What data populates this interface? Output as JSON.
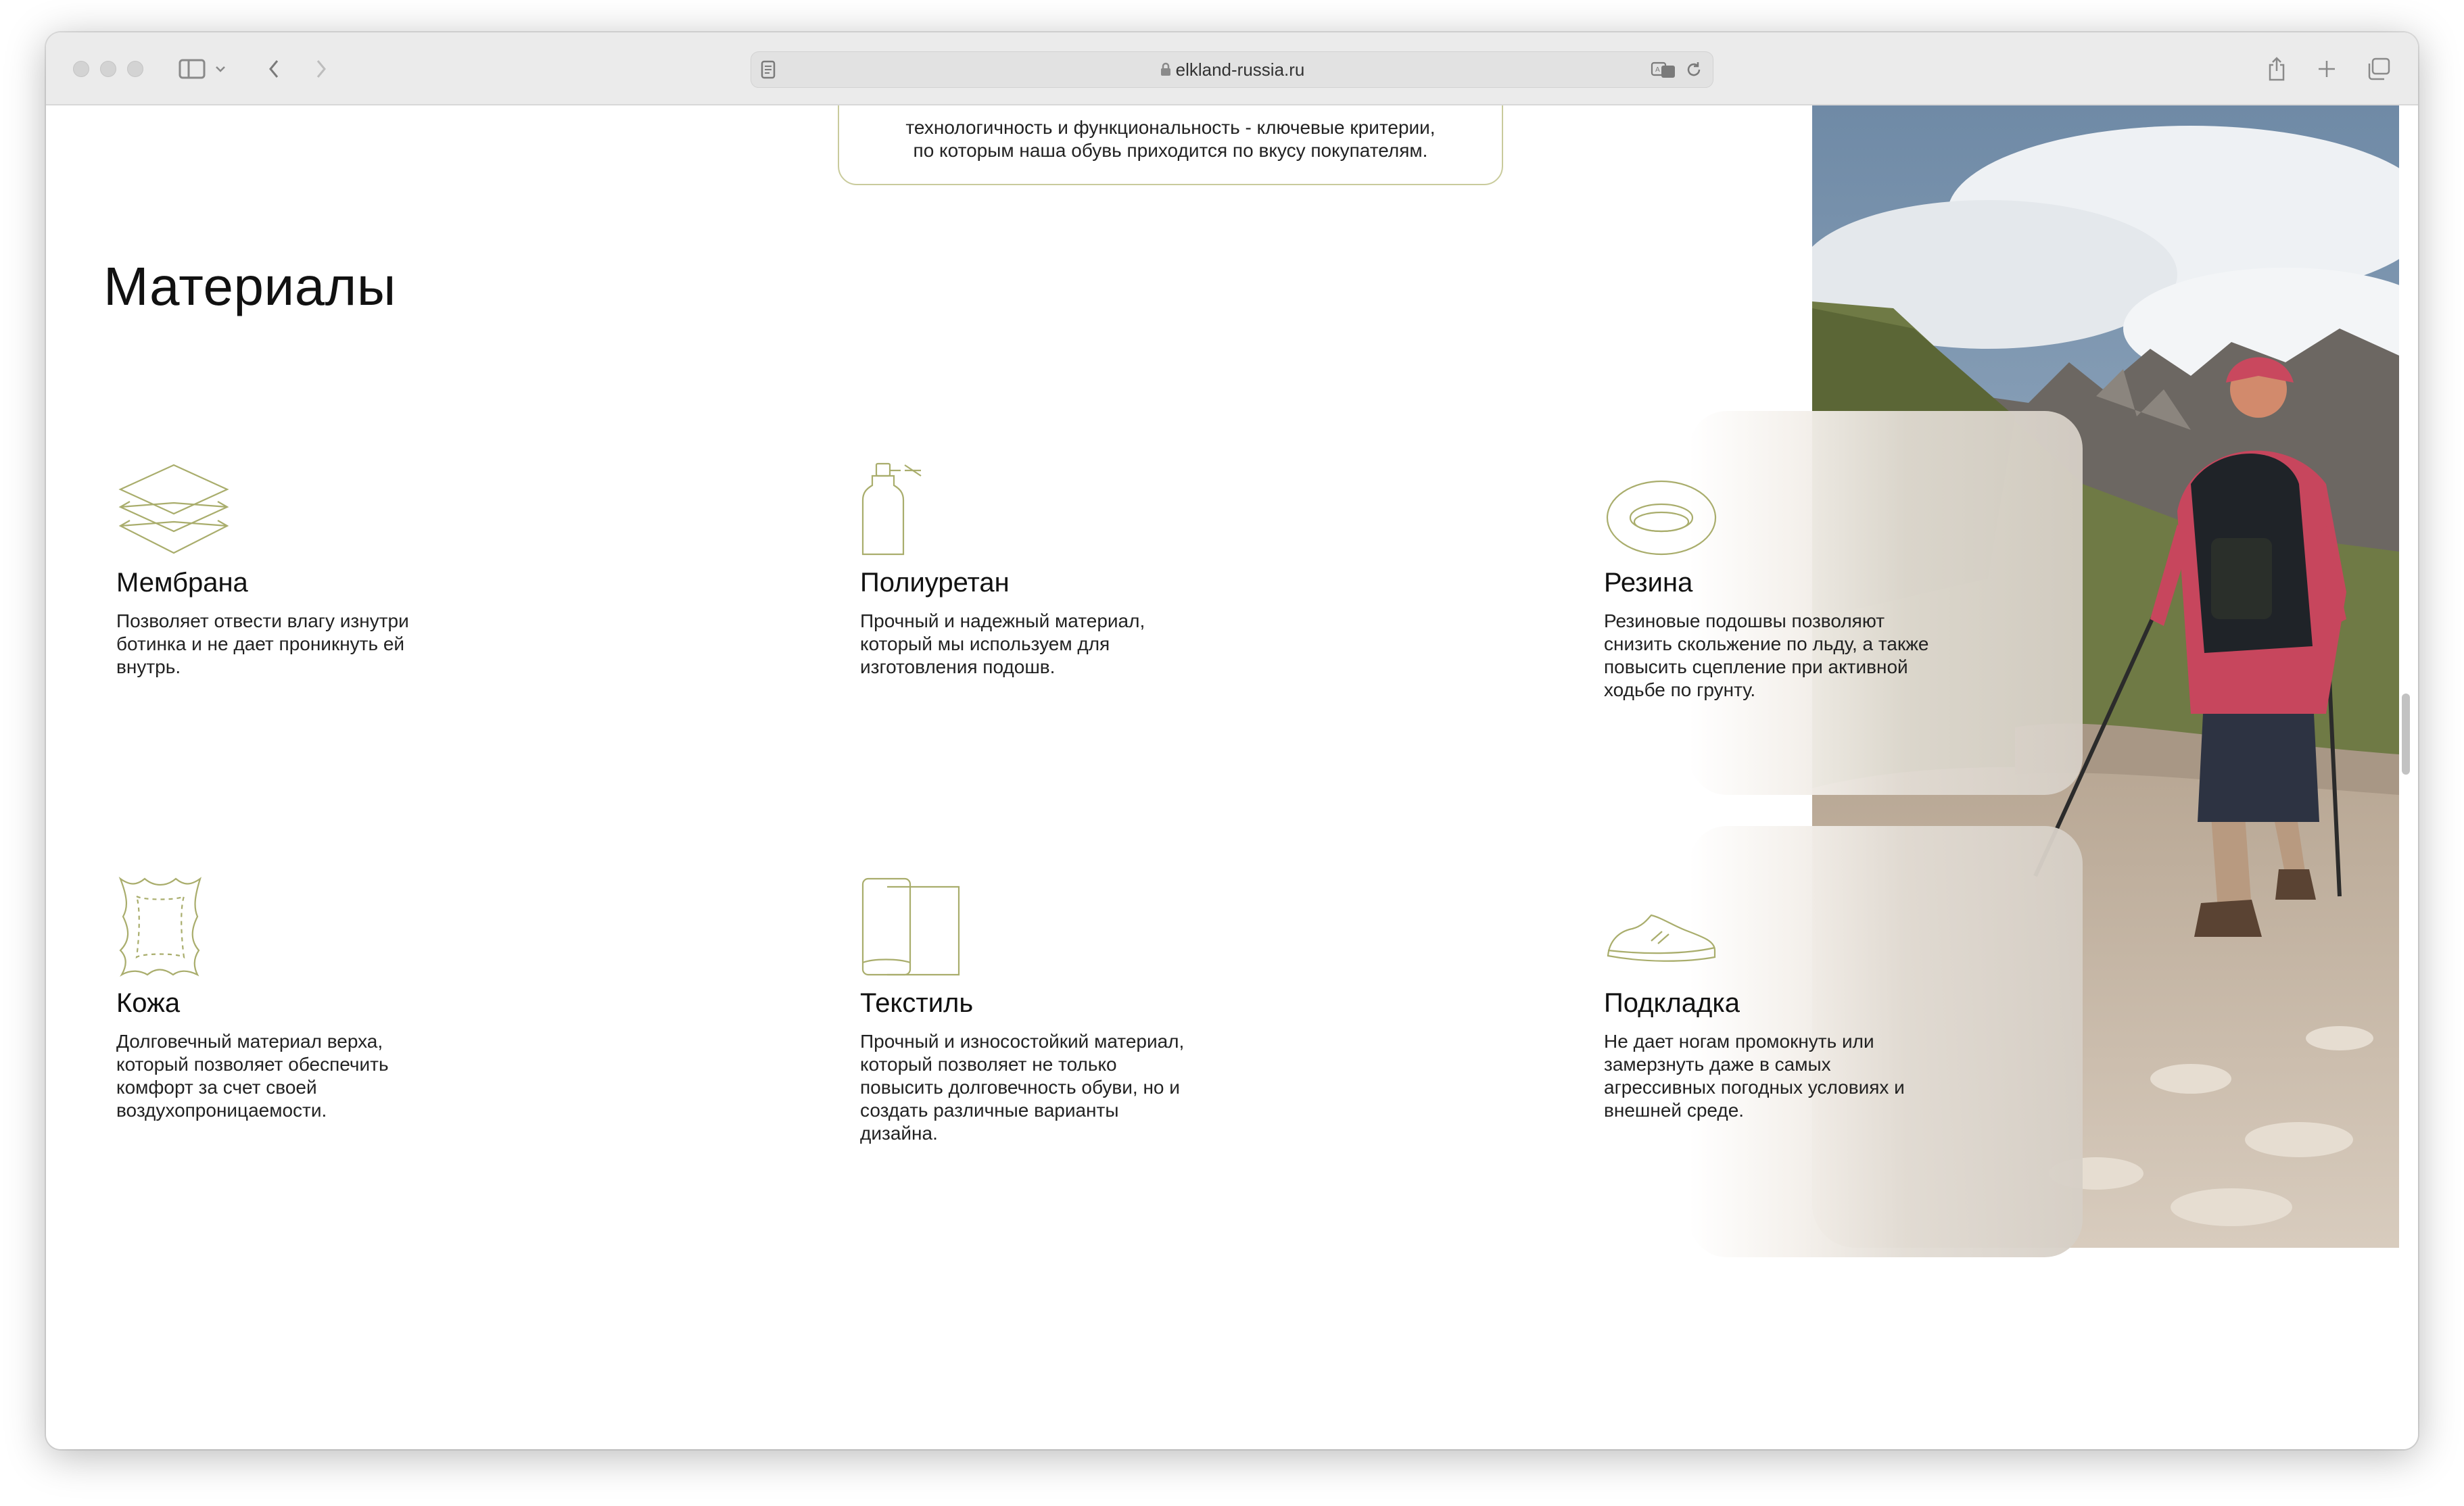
{
  "browser": {
    "url": "elkland-russia.ru"
  },
  "intro": {
    "line1": "технологичность и функциональность - ключевые критерии,",
    "line2": "по которым наша обувь приходится по вкусу покупателям."
  },
  "section": {
    "title": "Материалы"
  },
  "materials": [
    {
      "icon": "layers-icon",
      "title": "Мембрана",
      "desc": "Позволяет отвести влагу изнутри ботинка и не дает проникнуть ей внутрь."
    },
    {
      "icon": "spray-bottle-icon",
      "title": "Полиуретан",
      "desc": "Прочный и надежный материал, который мы используем для изготовления подошв."
    },
    {
      "icon": "rubber-ring-icon",
      "title": "Резина",
      "desc": "Резиновые подошвы позволяют снизить скольжение по льду, а также повысить сцепление при активной ходьбе по грунту."
    },
    {
      "icon": "leather-hide-icon",
      "title": "Кожа",
      "desc": "Долговечный материал верха, который позволяет обеспечить комфорт за счет своей воздухопроницаемости."
    },
    {
      "icon": "fabric-roll-icon",
      "title": "Текстиль",
      "desc": "Прочный и износостойкий материал, который позволяет не только повысить долговечность обуви, но и создать различные варианты дизайна."
    },
    {
      "icon": "sneaker-icon",
      "title": "Подкладка",
      "desc": "Не дает ногам промокнуть или замерзнуть даже в самых агрессивных погодных условиях и внешней среде."
    }
  ],
  "colors": {
    "accent": "#a9ad6c",
    "card_border": "#c9cb9c"
  }
}
